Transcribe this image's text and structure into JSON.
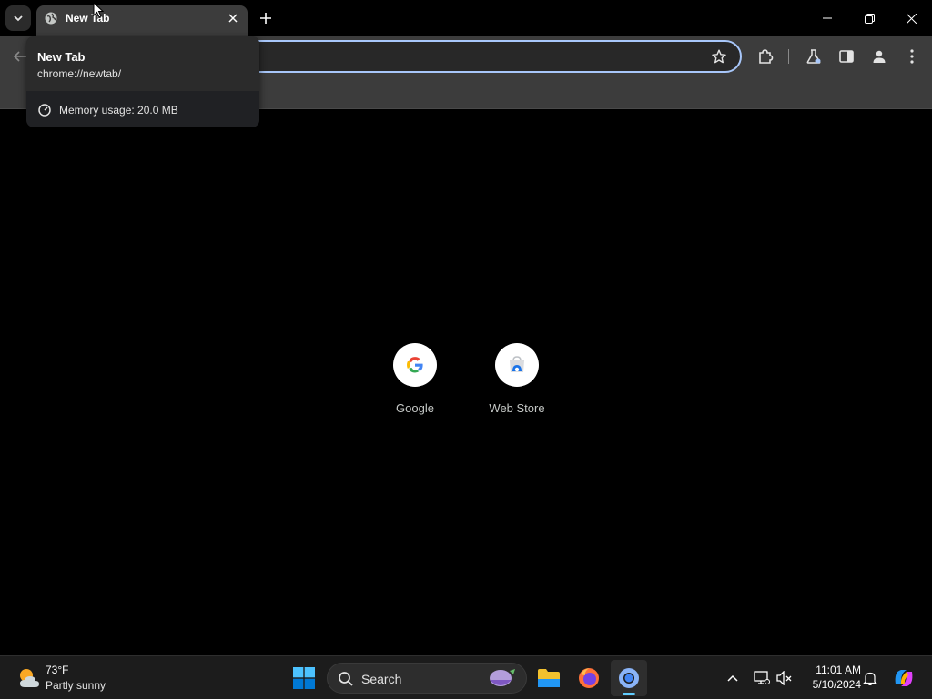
{
  "browser": {
    "tab": {
      "title": "New Tab"
    },
    "hover_card": {
      "title": "New Tab",
      "url": "chrome://newtab/",
      "memory": "Memory usage: 20.0 MB"
    },
    "toolbar_icons": [
      "back-arrow-icon",
      "star-icon",
      "extensions-icon",
      "labs-flask-icon",
      "side-panel-icon",
      "profile-icon",
      "more-menu-icon"
    ]
  },
  "ntp": {
    "shortcuts": [
      {
        "label": "Google",
        "icon": "google-g-icon"
      },
      {
        "label": "Web Store",
        "icon": "web-store-icon"
      }
    ]
  },
  "taskbar": {
    "weather": {
      "temp": "73°F",
      "desc": "Partly sunny"
    },
    "search_placeholder": "Search",
    "clock": {
      "time": "11:01 AM",
      "date": "5/10/2024"
    },
    "accent": "#60cdff"
  }
}
